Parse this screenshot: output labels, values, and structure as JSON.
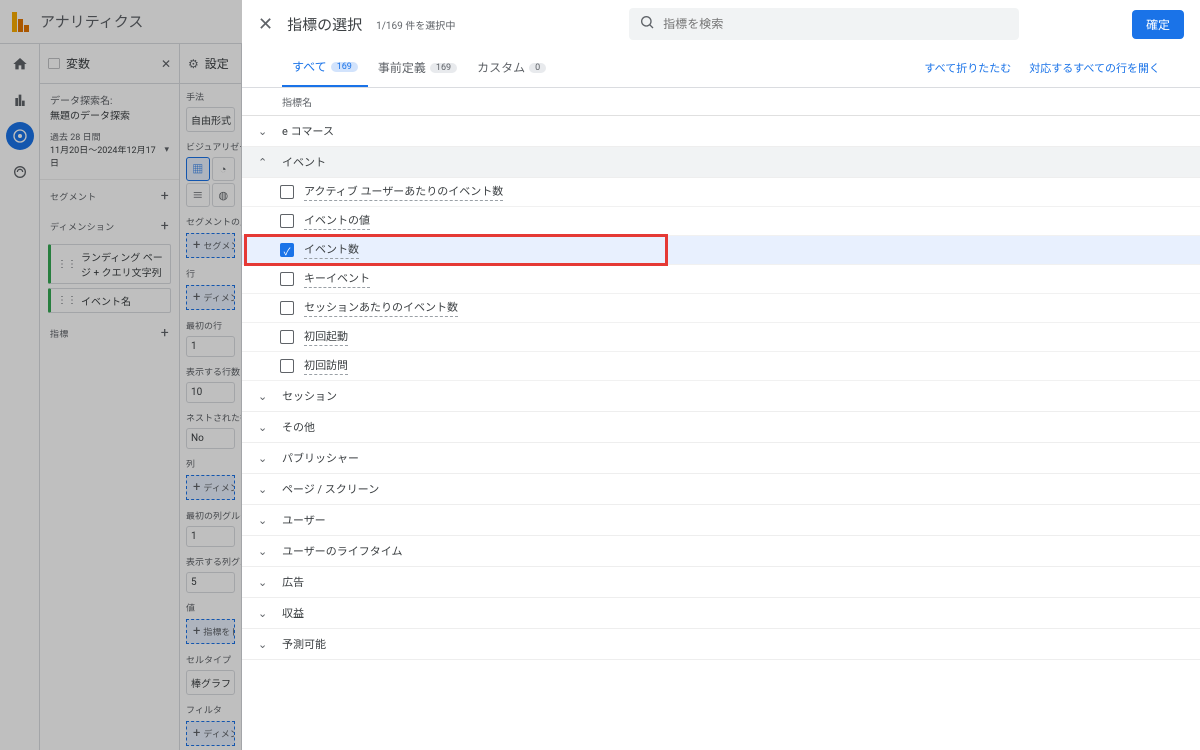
{
  "header": {
    "app": "アナリティクス"
  },
  "rail": {
    "icons": [
      "home",
      "reports",
      "explore",
      "ads"
    ]
  },
  "vars": {
    "title": "変数",
    "dataset_lbl": "データ探索名:",
    "dataset": "無題のデータ探索",
    "date_lbl": "過去 28 日間",
    "date_range": "11月20日～2024年12月17日",
    "seg_lbl": "セグメント",
    "dim_lbl": "ディメンション",
    "dim_chip1": "ランディング ページ + クエリ文字列",
    "dim_chip2": "イベント名",
    "metric_lbl": "指標"
  },
  "settings": {
    "title": "設定",
    "technique_lbl": "手法",
    "technique": "自由形式",
    "viz_lbl": "ビジュアリゼーシ",
    "segcmp_lbl": "セグメントの比較",
    "segcmp_drop": "セグメントをドロップするか選択し",
    "rows_lbl": "行",
    "rows_drop": "ディメンションをドロップするか選",
    "startrow_lbl": "最初の行",
    "startrow": "1",
    "showrows_lbl": "表示する行数",
    "showrows": "10",
    "nested_lbl": "ネストされた行",
    "nested": "No",
    "cols_lbl": "列",
    "cols_drop": "ディメンションをドロップするか選",
    "startcol_lbl": "最初の列グループ",
    "startcol": "1",
    "showcols_lbl": "表示する列グルー",
    "showcols": "5",
    "vals_lbl": "値",
    "vals_drop": "指標をドロップするか選択してくだ",
    "celltype_lbl": "セルタイプ",
    "celltype": "棒グラフ",
    "filter_lbl": "フィルタ",
    "filter_drop": "ディメンションやメトリクスをドロップするか選択してください"
  },
  "modal": {
    "title": "指標の選択",
    "count": "1/169 件を選択中",
    "search_ph": "指標を検索",
    "confirm": "確定",
    "tabs": [
      {
        "label": "すべて",
        "badge": "169",
        "active": true
      },
      {
        "label": "事前定義",
        "badge": "169"
      },
      {
        "label": "カスタム",
        "badge": "0"
      }
    ],
    "link_collapse": "すべて折りたたむ",
    "link_expand": "対応するすべての行を開く",
    "col_name": "指標名",
    "groups": [
      {
        "name": "e コマース",
        "expanded": false
      },
      {
        "name": "イベント",
        "expanded": true,
        "items": [
          {
            "label": "アクティブ ユーザーあたりのイベント数",
            "checked": false
          },
          {
            "label": "イベントの値",
            "checked": false
          },
          {
            "label": "イベント数",
            "checked": true,
            "highlight": true
          },
          {
            "label": "キーイベント",
            "checked": false
          },
          {
            "label": "セッションあたりのイベント数",
            "checked": false
          },
          {
            "label": "初回起動",
            "checked": false
          },
          {
            "label": "初回訪問",
            "checked": false
          }
        ]
      },
      {
        "name": "セッション",
        "expanded": false
      },
      {
        "name": "その他",
        "expanded": false
      },
      {
        "name": "パブリッシャー",
        "expanded": false
      },
      {
        "name": "ページ / スクリーン",
        "expanded": false
      },
      {
        "name": "ユーザー",
        "expanded": false
      },
      {
        "name": "ユーザーのライフタイム",
        "expanded": false
      },
      {
        "name": "広告",
        "expanded": false
      },
      {
        "name": "収益",
        "expanded": false
      },
      {
        "name": "予測可能",
        "expanded": false
      }
    ]
  }
}
